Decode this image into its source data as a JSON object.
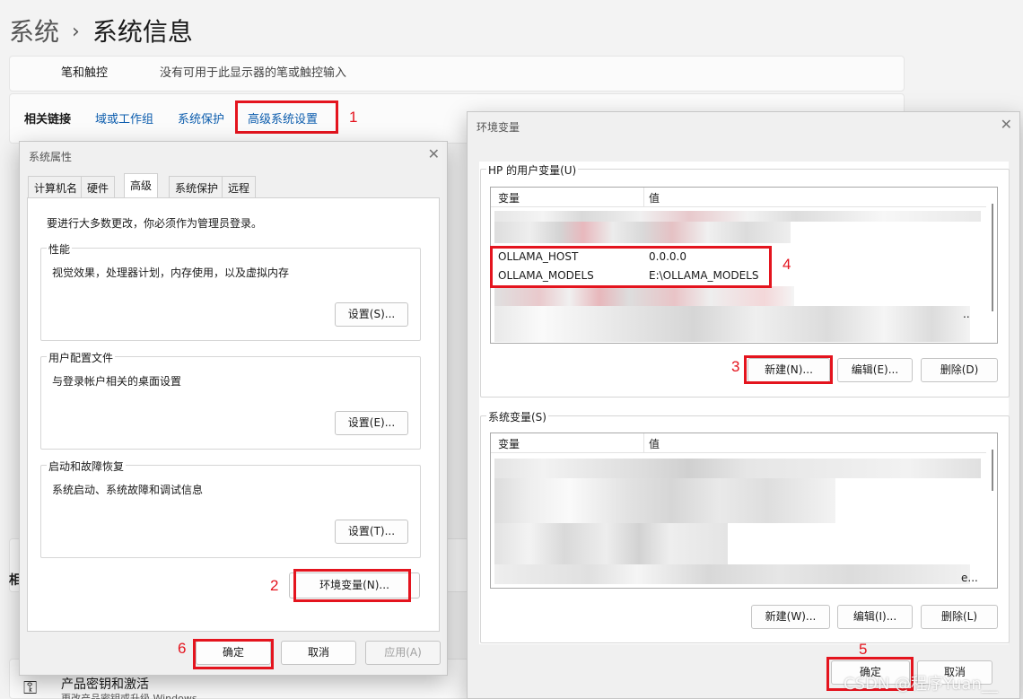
{
  "breadcrumb": {
    "parent": "系统",
    "current": "系统信息"
  },
  "pen": {
    "label": "笔和触控",
    "value": "没有可用于此显示器的笔或触控输入"
  },
  "related": {
    "title": "相关链接",
    "links": [
      "域或工作组",
      "系统保护",
      "高级系统设置"
    ]
  },
  "side_fragment": "相",
  "product": {
    "title": "产品密钥和激活",
    "sub": "更改产品密钥或升级 Windows"
  },
  "sysprops": {
    "title": "系统属性",
    "tabs": [
      "计算机名",
      "硬件",
      "高级",
      "系统保护",
      "远程"
    ],
    "admin_note": "要进行大多数更改，你必须作为管理员登录。",
    "perf": {
      "title": "性能",
      "desc": "视觉效果，处理器计划，内存使用，以及虚拟内存",
      "btn": "设置(S)..."
    },
    "profile": {
      "title": "用户配置文件",
      "desc": "与登录帐户相关的桌面设置",
      "btn": "设置(E)..."
    },
    "startup": {
      "title": "启动和故障恢复",
      "desc": "系统启动、系统故障和调试信息",
      "btn": "设置(T)..."
    },
    "env_btn": "环境变量(N)...",
    "ok": "确定",
    "cancel": "取消",
    "apply": "应用(A)"
  },
  "envvars": {
    "title": "环境变量",
    "user_group": "HP 的用户变量(U)",
    "col_var": "变量",
    "col_val": "值",
    "user_vars": [
      {
        "name": "OLLAMA_HOST",
        "value": "0.0.0.0"
      },
      {
        "name": "OLLAMA_MODELS",
        "value": "E:\\OLLAMA_MODELS"
      }
    ],
    "user_trunc": "..",
    "user_btns": [
      "新建(N)...",
      "编辑(E)...",
      "删除(D)"
    ],
    "sys_group": "系统变量(S)",
    "sys_trunc": "e...",
    "sys_btns": [
      "新建(W)...",
      "编辑(I)...",
      "删除(L)"
    ],
    "ok": "确定",
    "cancel": "取消"
  },
  "annotations": [
    "1",
    "2",
    "3",
    "4",
    "5",
    "6"
  ],
  "watermark": "CSDN @程序Yuan__",
  "colors": {
    "annotation_red": "#e4141e",
    "link_blue": "#0b5cad"
  }
}
